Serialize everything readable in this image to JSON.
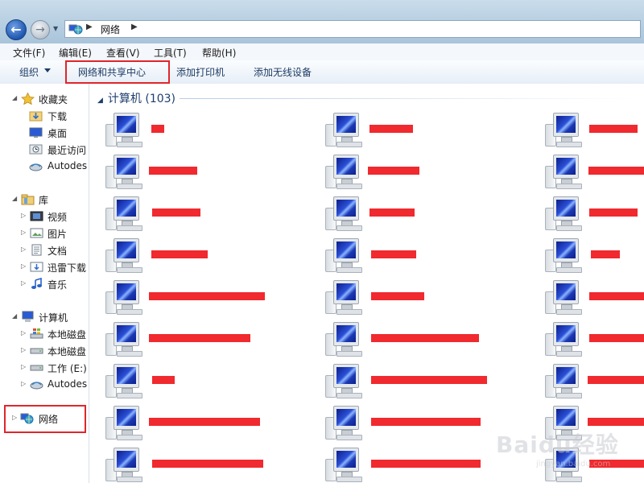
{
  "address": {
    "segment": "网络"
  },
  "menu": [
    "文件(F)",
    "编辑(E)",
    "查看(V)",
    "工具(T)",
    "帮助(H)"
  ],
  "command_bar": {
    "organize": "组织",
    "network_center": "网络和共享中心",
    "add_printer": "添加打印机",
    "add_wireless": "添加无线设备"
  },
  "nav": {
    "favorites": "收藏夹",
    "downloads": "下载",
    "desktop": "桌面",
    "recent": "最近访问",
    "autodesk1": "Autodes",
    "library": "库",
    "videos": "视频",
    "pictures": "图片",
    "documents": "文档",
    "xunlei": "迅雷下载",
    "music": "音乐",
    "computer": "计算机",
    "disk1": "本地磁盘",
    "disk2": "本地磁盘",
    "work_e": "工作 (E:)",
    "autodesk2": "Autodes",
    "network": "网络"
  },
  "content": {
    "group_title": "计算机 (103)"
  },
  "colors": {
    "redaction": "#f02a2e",
    "highlight": "#e0262b",
    "header_text": "#1e3e6e"
  },
  "watermark": {
    "logo": "Baidu经验",
    "url": "jingyan.baidu.com"
  }
}
